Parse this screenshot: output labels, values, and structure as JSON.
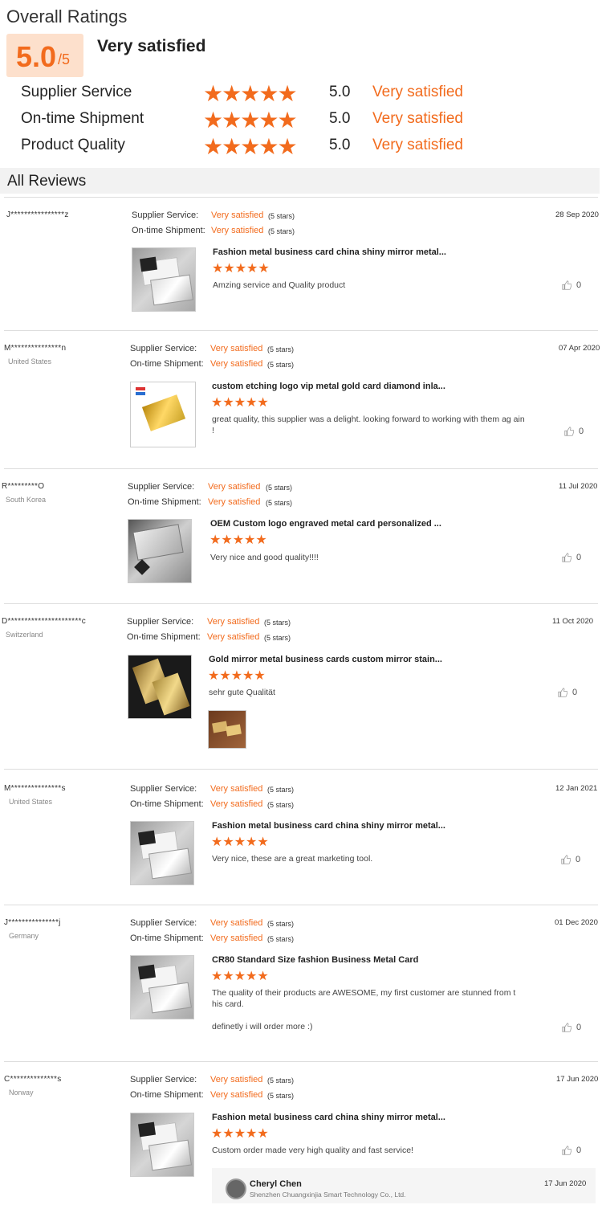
{
  "overall": {
    "title": "Overall Ratings",
    "score": "5.0",
    "score_max": "/5",
    "label": "Very satisfied",
    "criteria": [
      {
        "name": "Supplier Service",
        "score": "5.0",
        "label": "Very satisfied",
        "stars": 5
      },
      {
        "name": "On-time Shipment",
        "score": "5.0",
        "label": "Very satisfied",
        "stars": 5
      },
      {
        "name": "Product Quality",
        "score": "5.0",
        "label": "Very satisfied",
        "stars": 5
      }
    ]
  },
  "reviews_title": "All Reviews",
  "labels": {
    "supplier_service": "Supplier Service:",
    "on_time_shipment": "On-time Shipment:",
    "very_satisfied": "Very satisfied",
    "five_stars": "(5 stars)"
  },
  "reviews": [
    {
      "user": "J****************z",
      "country": "",
      "date": "28 Sep 2020",
      "product": "Fashion metal business card china shiny mirror metal...",
      "rating": 5,
      "text": "Amzing service and Quality product",
      "likes": "0"
    },
    {
      "user": "M***************n",
      "country": "United States",
      "date": "07 Apr 2020",
      "product": "custom etching logo vip metal gold card diamond inla...",
      "rating": 5,
      "text": "great quality, this supplier was a delight. looking forward to working with them ag ain !",
      "likes": "0"
    },
    {
      "user": "R*********O",
      "country": "South Korea",
      "date": "11 Jul 2020",
      "product": "OEM Custom logo engraved metal card personalized ...",
      "rating": 5,
      "text": "Very nice and good quality!!!!",
      "likes": "0"
    },
    {
      "user": "D**********************c",
      "country": "Switzerland",
      "date": "11 Oct 2020",
      "product": "Gold mirror metal business cards custom mirror stain...",
      "rating": 5,
      "text": "sehr gute Qualität",
      "likes": "0"
    },
    {
      "user": "M***************s",
      "country": "United States",
      "date": "12 Jan 2021",
      "product": "Fashion metal business card china shiny mirror metal...",
      "rating": 5,
      "text": "Very nice, these are a great marketing tool.",
      "likes": "0"
    },
    {
      "user": "J***************j",
      "country": "Germany",
      "date": "01 Dec 2020",
      "product": "CR80 Standard Size fashion Business Metal Card",
      "rating": 5,
      "text": "The quality of their products are AWESOME, my first customer are stunned from t his card.",
      "text2": "definetly i will order more :)",
      "likes": "0"
    },
    {
      "user": "C**************s",
      "country": "Norway",
      "date": "17 Jun 2020",
      "product": "Fashion metal business card china shiny mirror metal...",
      "rating": 5,
      "text": "Custom order made very high quality and fast service!",
      "likes": "0",
      "reply": {
        "name": "Cheryl Chen",
        "company": "Shenzhen Chuangxinjia Smart Technology Co., Ltd.",
        "date": "17 Jun 2020"
      }
    }
  ],
  "colors": {
    "accent": "#f26b1d",
    "score_bg": "#fde0cc",
    "bar_bg": "#f2f2f2"
  },
  "icons": {
    "star": "star-icon",
    "thumb": "thumbs-up-icon"
  }
}
